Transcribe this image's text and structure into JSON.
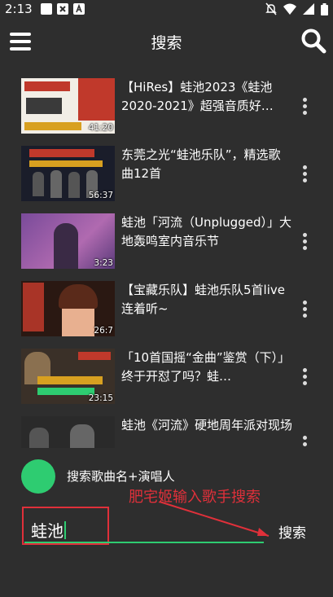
{
  "status_bar": {
    "time": "2:13"
  },
  "app_bar": {
    "title": "搜索"
  },
  "videos": [
    {
      "title": "【HiRes】蛙池2023《蛙池2020-2021》超强音质好…",
      "duration": "41:20"
    },
    {
      "title": "东莞之光“蛙池乐队”，精选歌曲12首",
      "duration": "56:37"
    },
    {
      "title": "蛙池「河流（Unplugged）」大地轰鸣室内音乐节",
      "duration": "3:23"
    },
    {
      "title": "【宝藏乐队】蛙池乐队5首live连着听~",
      "duration": "26:7"
    },
    {
      "title": "「10首国摇“金曲”鉴赏（下）」终于开怼了吗？蛙…",
      "duration": "23:15"
    },
    {
      "title": "蛙池《河流》硬地周年派对现场",
      "duration": ""
    }
  ],
  "hint": {
    "text": "搜索歌曲名+演唱人"
  },
  "annotation": {
    "text": "肥宅姬输入歌手搜索"
  },
  "search": {
    "value": "蛙池",
    "button_label": "搜索"
  },
  "colors": {
    "accent": "#2ecc71",
    "annotation": "#e0303a",
    "background": "#2e2e2e"
  }
}
